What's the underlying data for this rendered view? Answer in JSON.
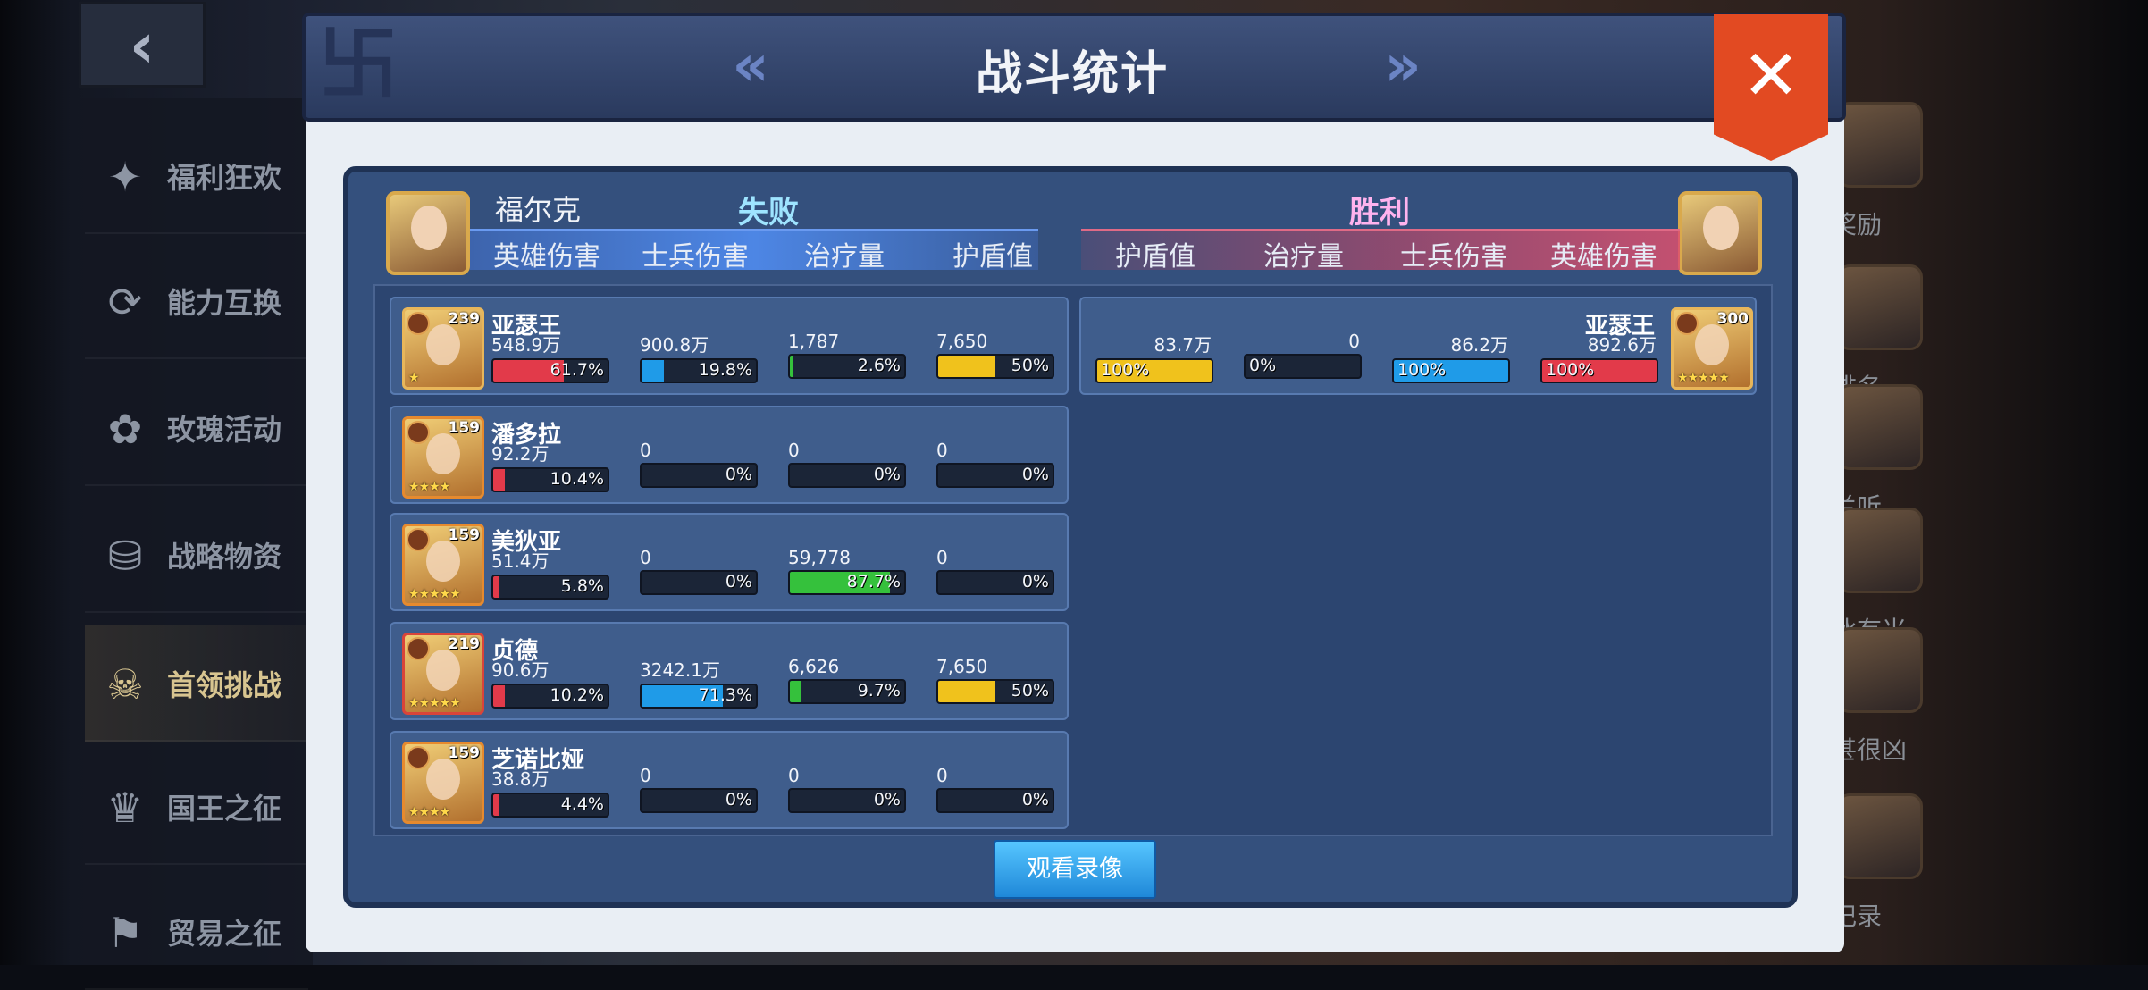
{
  "back": {
    "glyph": "‹"
  },
  "sidebar": {
    "items": [
      {
        "label": "福利狂欢",
        "icon": "party-icon",
        "glyph": "✦",
        "active": false
      },
      {
        "label": "能力互换",
        "icon": "swap-icon",
        "glyph": "⟳",
        "active": false
      },
      {
        "label": "玫瑰活动",
        "icon": "rose-icon",
        "glyph": "✿",
        "active": false
      },
      {
        "label": "战略物资",
        "icon": "supplies-icon",
        "glyph": "⛁",
        "active": false
      },
      {
        "label": "首领挑战",
        "icon": "skull-icon",
        "glyph": "☠",
        "active": true
      },
      {
        "label": "国王之征",
        "icon": "crown-icon",
        "glyph": "♛",
        "active": false
      },
      {
        "label": "贸易之征",
        "icon": "trade-icon",
        "glyph": "⚑",
        "active": false
      }
    ]
  },
  "right_strip": {
    "labels": [
      "奖励",
      "排名",
      "兰听...",
      "冰有米",
      "甚很凶",
      "记录"
    ]
  },
  "dialog": {
    "title": "战斗统计",
    "prev_glyph": "«",
    "next_glyph": "»",
    "close_glyph": "✕",
    "deco_glyph": "卐"
  },
  "left_side": {
    "player_name": "福尔克",
    "result": "失败",
    "columns": [
      "英雄伤害",
      "士兵伤害",
      "治疗量",
      "护盾值"
    ]
  },
  "right_side": {
    "result": "胜利",
    "columns": [
      "护盾值",
      "治疗量",
      "士兵伤害",
      "英雄伤害"
    ]
  },
  "colors": {
    "hero_damage": "#e23a4a",
    "soldier_damage": "#1f9be8",
    "healing": "#35c13c",
    "shield": "#f0c21c"
  },
  "left_heroes": [
    {
      "name": "亚瑟王",
      "level": "239",
      "stars": "★",
      "frame": "gold",
      "stats": [
        {
          "value": "548.9万",
          "pct": "61.7%",
          "fill": 0.617
        },
        {
          "value": "900.8万",
          "pct": "19.8%",
          "fill": 0.198
        },
        {
          "value": "1,787",
          "pct": "2.6%",
          "fill": 0.026
        },
        {
          "value": "7,650",
          "pct": "50%",
          "fill": 0.5
        }
      ]
    },
    {
      "name": "潘多拉",
      "level": "159",
      "stars": "★★★★",
      "frame": "orange",
      "stats": [
        {
          "value": "92.2万",
          "pct": "10.4%",
          "fill": 0.104
        },
        {
          "value": "0",
          "pct": "0%",
          "fill": 0
        },
        {
          "value": "0",
          "pct": "0%",
          "fill": 0
        },
        {
          "value": "0",
          "pct": "0%",
          "fill": 0
        }
      ]
    },
    {
      "name": "美狄亚",
      "level": "159",
      "stars": "★★★★★",
      "frame": "orange",
      "stats": [
        {
          "value": "51.4万",
          "pct": "5.8%",
          "fill": 0.058
        },
        {
          "value": "0",
          "pct": "0%",
          "fill": 0
        },
        {
          "value": "59,778",
          "pct": "87.7%",
          "fill": 0.877
        },
        {
          "value": "0",
          "pct": "0%",
          "fill": 0
        }
      ]
    },
    {
      "name": "贞德",
      "level": "219",
      "stars": "★★★★★",
      "frame": "red",
      "stats": [
        {
          "value": "90.6万",
          "pct": "10.2%",
          "fill": 0.102
        },
        {
          "value": "3242.1万",
          "pct": "71.3%",
          "fill": 0.713
        },
        {
          "value": "6,626",
          "pct": "9.7%",
          "fill": 0.097
        },
        {
          "value": "7,650",
          "pct": "50%",
          "fill": 0.5
        }
      ]
    },
    {
      "name": "芝诺比娅",
      "level": "159",
      "stars": "★★★★",
      "frame": "orange",
      "stats": [
        {
          "value": "38.8万",
          "pct": "4.4%",
          "fill": 0.044
        },
        {
          "value": "0",
          "pct": "0%",
          "fill": 0
        },
        {
          "value": "0",
          "pct": "0%",
          "fill": 0
        },
        {
          "value": "0",
          "pct": "0%",
          "fill": 0
        }
      ]
    }
  ],
  "right_heroes": [
    {
      "name": "亚瑟王",
      "level": "300",
      "stars": "★★★★★",
      "frame": "gold",
      "stats": [
        {
          "value": "83.7万",
          "pct": "100%",
          "fill": 1.0
        },
        {
          "value": "0",
          "pct": "0%",
          "fill": 0
        },
        {
          "value": "86.2万",
          "pct": "100%",
          "fill": 1.0
        },
        {
          "value": "892.6万",
          "pct": "100%",
          "fill": 1.0
        }
      ]
    }
  ],
  "replay_button": "观看录像"
}
